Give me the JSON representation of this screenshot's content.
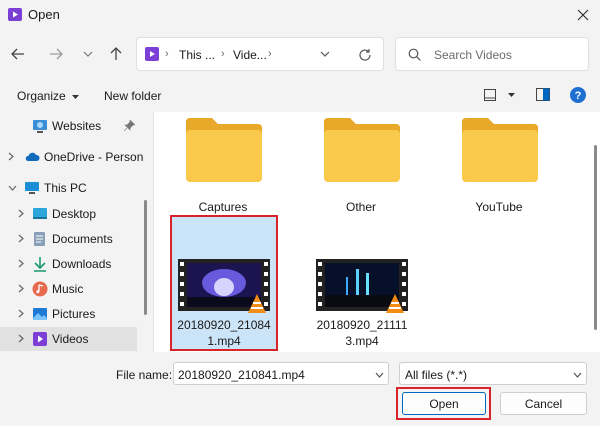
{
  "window": {
    "title": "Open"
  },
  "address": {
    "segments": [
      "This ...",
      "Vide..."
    ]
  },
  "search": {
    "placeholder": "Search Videos"
  },
  "toolbar": {
    "organize_label": "Organize",
    "new_folder_label": "New folder"
  },
  "sidebar": {
    "items": [
      {
        "label": "Websites",
        "icon": "globe-icon",
        "pinned": true
      },
      {
        "label": "OneDrive - Person",
        "icon": "cloud-icon"
      },
      {
        "label": "This PC",
        "icon": "monitor-icon"
      },
      {
        "label": "Desktop",
        "icon": "desktop-icon"
      },
      {
        "label": "Documents",
        "icon": "documents-icon"
      },
      {
        "label": "Downloads",
        "icon": "download-icon"
      },
      {
        "label": "Music",
        "icon": "music-icon"
      },
      {
        "label": "Pictures",
        "icon": "pictures-icon"
      },
      {
        "label": "Videos",
        "icon": "videos-icon",
        "selected": true
      }
    ]
  },
  "folders": [
    {
      "name": "Captures"
    },
    {
      "name": "Other"
    },
    {
      "name": "YouTube"
    }
  ],
  "files": [
    {
      "name_line1": "20180920_21084",
      "name_line2": "1.mp4",
      "selected": true
    },
    {
      "name_line1": "20180920_21111",
      "name_line2": "3.mp4",
      "selected": false
    }
  ],
  "bottom": {
    "file_name_label": "File name:",
    "file_name_value": "20180920_210841.mp4",
    "filter_value": "All files (*.*)",
    "open_label": "Open",
    "cancel_label": "Cancel"
  },
  "colors": {
    "selection_fill": "#cce4f7",
    "highlight_box": "#d8232a",
    "accent": "#0067c0",
    "folder": "#f8c94b"
  }
}
